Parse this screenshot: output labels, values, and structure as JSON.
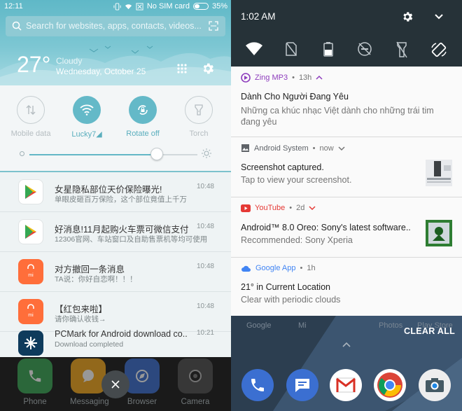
{
  "left": {
    "status_bar": {
      "time": "12:11",
      "sim": "No SIM card",
      "battery": "35%"
    },
    "search": {
      "placeholder": "Search for websites, apps, contacts, videos..."
    },
    "weather": {
      "temperature": "27°",
      "condition": "Cloudy",
      "date": "Wednesday, October 25"
    },
    "quick_settings": [
      {
        "label": "Mobile data",
        "state": "off",
        "icon": "data-arrows-icon"
      },
      {
        "label": "Lucky7◢",
        "state": "on",
        "icon": "wifi-icon"
      },
      {
        "label": "Rotate off",
        "state": "on",
        "icon": "rotate-lock-icon"
      },
      {
        "label": "Torch",
        "state": "off",
        "icon": "torch-icon"
      }
    ],
    "brightness": 0.76,
    "notifications": [
      {
        "title": "女星隐私部位天价保险曝光!",
        "body": "单眼皮砸百万保险，这个部位竟值上千万",
        "time": "10:48",
        "icon": "play-store-icon"
      },
      {
        "title": "好消息!11月起购火车票可微信支付",
        "body": "12306官网、车站窗口及自助售票机等均可使用",
        "time": "10:48",
        "icon": "play-store-icon"
      },
      {
        "title": "对方撤回一条消息",
        "body": "TA说：你好自恋啊！！！",
        "time": "10:48",
        "icon": "mi-store-icon"
      },
      {
        "title": "【红包来啦】",
        "body": "请你确认收钱→",
        "time": "10:48",
        "icon": "mi-store-icon"
      },
      {
        "title": "PCMark for Android download co..",
        "body": "Download completed",
        "time": "10:21",
        "icon": "pcmark-icon"
      }
    ],
    "dock": [
      "Phone",
      "Messaging",
      "Browser",
      "Camera"
    ]
  },
  "right": {
    "time": "1:02 AM",
    "quick_settings": [
      "wifi-icon",
      "no-sim-icon",
      "battery-icon",
      "dnd-icon",
      "flashlight-off-icon",
      "auto-rotate-icon"
    ],
    "notifications": [
      {
        "app": "Zing MP3",
        "meta": "13h",
        "title": "Dành Cho Người Đang Yêu",
        "body": "Những ca khúc nhạc Việt dành cho những trái tim đang yêu",
        "color": "#8e3dbd"
      },
      {
        "app": "Android System",
        "meta": "now",
        "title": "Screenshot captured.",
        "body": "Tap to view your screenshot.",
        "color": "#5f6368"
      },
      {
        "app": "YouTube",
        "meta": "2d",
        "title": "Android™ 8.0 Oreo: Sony's latest software..",
        "body": "Recommended: Sony Xperia",
        "color": "#e53935"
      },
      {
        "app": "Google App",
        "meta": "1h",
        "title": "21° in Current Location",
        "body": "Clear with periodic clouds",
        "color": "#4285f4"
      }
    ],
    "bg_labels": [
      "Google",
      "Mi",
      "Photos",
      "Play Store"
    ],
    "clear_all": "CLEAR ALL"
  }
}
